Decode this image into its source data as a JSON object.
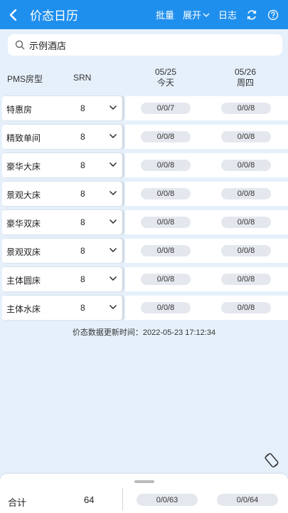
{
  "header": {
    "title": "价态日历",
    "batch_label": "批量",
    "expand_label": "展开",
    "log_label": "日志"
  },
  "search": {
    "value": "示例酒店"
  },
  "table": {
    "col_room_type": "PMS房型",
    "col_srn": "SRN",
    "dates": [
      {
        "date": "05/25",
        "day": "今天"
      },
      {
        "date": "05/26",
        "day": "周四"
      }
    ],
    "rows": [
      {
        "name": "特惠房",
        "srn": "8",
        "d1": "0/0/7",
        "d2": "0/0/8"
      },
      {
        "name": "精致单间",
        "srn": "8",
        "d1": "0/0/8",
        "d2": "0/0/8"
      },
      {
        "name": "豪华大床",
        "srn": "8",
        "d1": "0/0/8",
        "d2": "0/0/8"
      },
      {
        "name": "景观大床",
        "srn": "8",
        "d1": "0/0/8",
        "d2": "0/0/8"
      },
      {
        "name": "豪华双床",
        "srn": "8",
        "d1": "0/0/8",
        "d2": "0/0/8"
      },
      {
        "name": "景观双床",
        "srn": "8",
        "d1": "0/0/8",
        "d2": "0/0/8"
      },
      {
        "name": "主体圆床",
        "srn": "8",
        "d1": "0/0/8",
        "d2": "0/0/8"
      },
      {
        "name": "主体水床",
        "srn": "8",
        "d1": "0/0/8",
        "d2": "0/0/8"
      }
    ]
  },
  "updated_text": "价态数据更新时间：2022-05-23 17:12:34",
  "footer": {
    "total_label": "合计",
    "total_value": "64",
    "d1": "0/0/63",
    "d2": "0/0/64"
  },
  "colors": {
    "brand": "#1f8fed",
    "background": "#e6f0fb"
  },
  "icons": [
    "back-arrow-icon",
    "chevron-down-icon",
    "refresh-icon",
    "help-icon",
    "search-icon",
    "rotate-screen-icon"
  ]
}
